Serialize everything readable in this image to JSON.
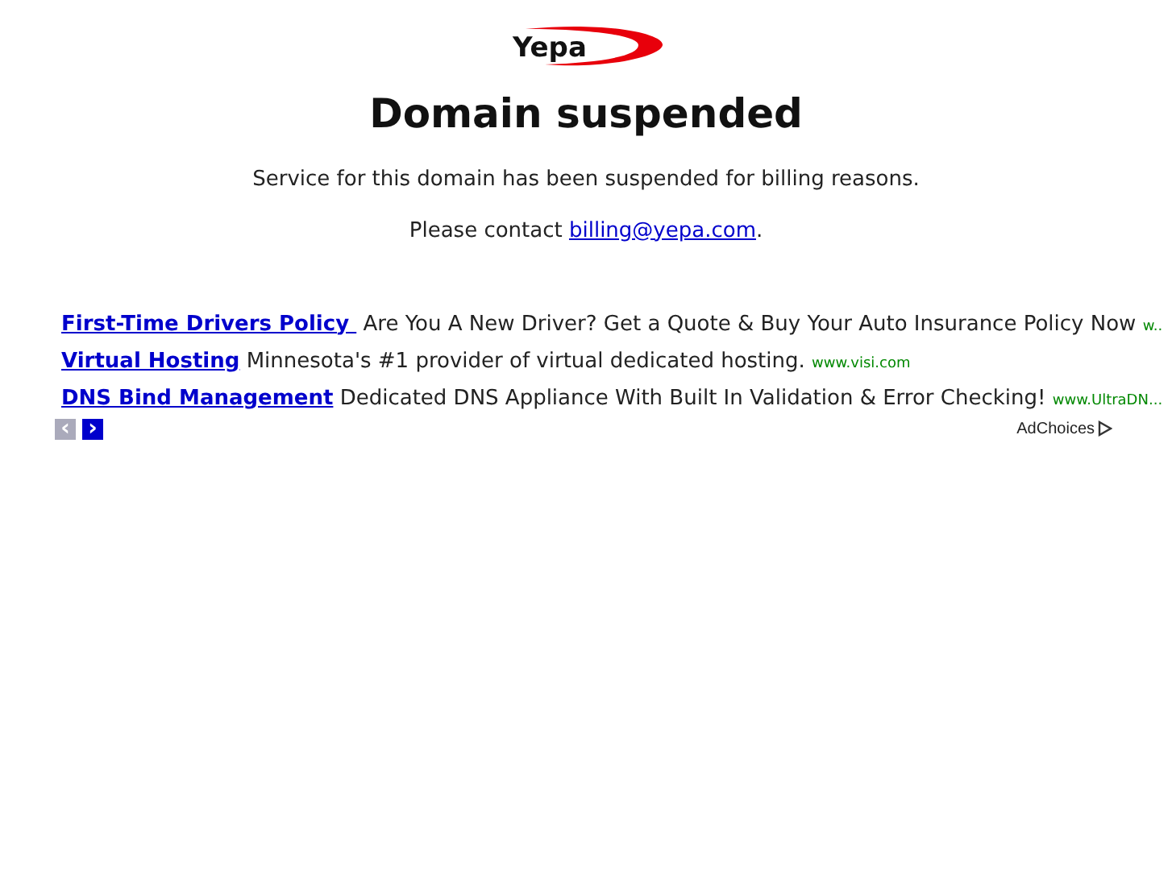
{
  "logo": {
    "text": "Yepa"
  },
  "heading": "Domain suspended",
  "message": "Service for this domain has been suspended for billing reasons.",
  "contact": {
    "before": "Please contact ",
    "link": "billing@yepa.com",
    "after": "."
  },
  "ads": [
    {
      "title": "First-Time Drivers Policy ",
      "body": "Are You A New Driver? Get a Quote & Buy Your Auto Insurance Policy Now",
      "url": "w.."
    },
    {
      "title": "Virtual Hosting",
      "body": "Minnesota's #1 provider of virtual dedicated hosting.",
      "url": "www.visi.com"
    },
    {
      "title": "DNS Bind Management",
      "body": "Dedicated DNS Appliance With Built In Validation & Error Checking!",
      "url": "www.UltraDN..."
    }
  ],
  "pager": [
    {
      "icon": "‹",
      "disabled": true
    },
    {
      "icon": "›",
      "disabled": false
    }
  ],
  "adchoices": "AdChoices"
}
